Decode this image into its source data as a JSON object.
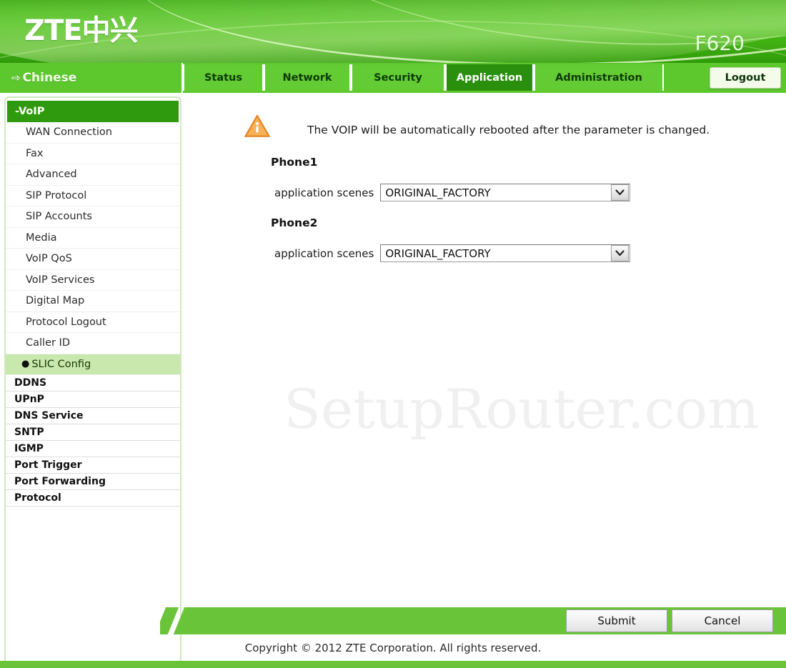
{
  "header": {
    "logo_text": "ZTE中兴",
    "model": "F620"
  },
  "nav": {
    "language_label": "Chinese",
    "language_icon": "arrow-right-icon",
    "tabs": [
      {
        "label": "Status",
        "active": false
      },
      {
        "label": "Network",
        "active": false
      },
      {
        "label": "Security",
        "active": false
      },
      {
        "label": "Application",
        "active": true
      },
      {
        "label": "Administration",
        "active": false
      }
    ],
    "logout_label": "Logout"
  },
  "sidebar": {
    "menu_head": "-VoIP",
    "sub_items": [
      {
        "label": "WAN Connection",
        "selected": false
      },
      {
        "label": "Fax",
        "selected": false
      },
      {
        "label": "Advanced",
        "selected": false
      },
      {
        "label": "SIP Protocol",
        "selected": false
      },
      {
        "label": "SIP Accounts",
        "selected": false
      },
      {
        "label": "Media",
        "selected": false
      },
      {
        "label": "VoIP QoS",
        "selected": false
      },
      {
        "label": "VoIP Services",
        "selected": false
      },
      {
        "label": "Digital Map",
        "selected": false
      },
      {
        "label": "Protocol Logout",
        "selected": false
      },
      {
        "label": "Caller ID",
        "selected": false
      },
      {
        "label": "SLIC Config",
        "selected": true
      }
    ],
    "top_items": [
      {
        "label": "DDNS"
      },
      {
        "label": "UPnP"
      },
      {
        "label": "DNS Service"
      },
      {
        "label": "SNTP"
      },
      {
        "label": "IGMP"
      },
      {
        "label": "Port Trigger"
      },
      {
        "label": "Port Forwarding"
      },
      {
        "label": "Protocol"
      }
    ]
  },
  "content": {
    "watermark": "SetupRouter.com",
    "notice_icon": "warning-triangle-icon",
    "notice_text": "The VOIP will be automatically rebooted after the parameter is changed.",
    "sections": [
      {
        "heading": "Phone1",
        "field_label": "application scenes",
        "field_value": "ORIGINAL_FACTORY"
      },
      {
        "heading": "Phone2",
        "field_label": "application scenes",
        "field_value": "ORIGINAL_FACTORY"
      }
    ]
  },
  "footer": {
    "submit_label": "Submit",
    "cancel_label": "Cancel",
    "copyright": "Copyright © 2012 ZTE Corporation. All rights reserved."
  },
  "colors": {
    "brand_green": "#43b814",
    "nav_green": "#5dc72e",
    "tab_green": "#63cc34",
    "active_tab_green": "#2a8f0c",
    "footer_green": "#6ac43a",
    "selected_item_green": "#c9e8ad",
    "warning_orange": "#f0962a"
  }
}
